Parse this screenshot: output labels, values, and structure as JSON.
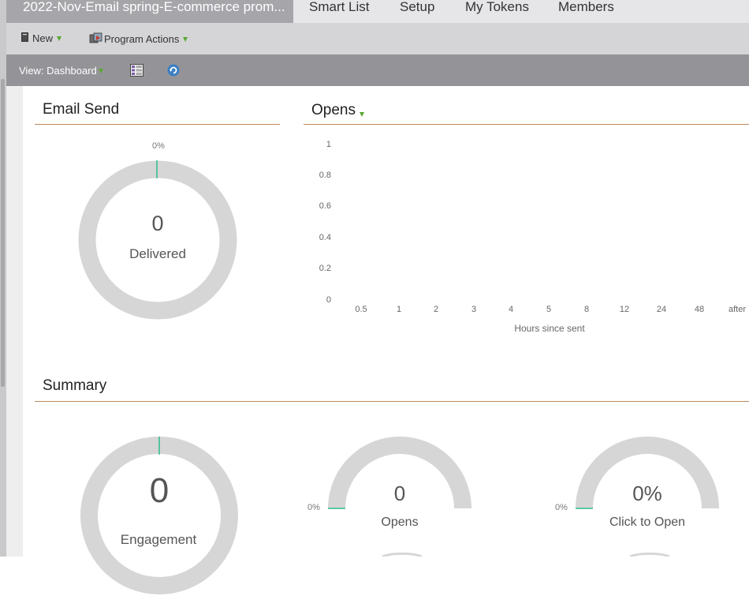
{
  "header": {
    "active_tab": "2022-Nov-Email spring-E-commerce prom...",
    "tabs": [
      "Smart List",
      "Setup",
      "My Tokens",
      "Members"
    ]
  },
  "toolbar": {
    "new_label": "New",
    "program_actions_label": "Program Actions"
  },
  "viewbar": {
    "view_label": "View: Dashboard"
  },
  "email_send": {
    "title": "Email Send",
    "percent_label": "0%",
    "count": "0",
    "label": "Delivered"
  },
  "opens_chart": {
    "title": "Opens",
    "y_ticks": [
      "1",
      "0.8",
      "0.6",
      "0.4",
      "0.2",
      "0"
    ],
    "x_ticks": [
      "0.5",
      "1",
      "2",
      "3",
      "4",
      "5",
      "8",
      "12",
      "24",
      "48",
      "after"
    ],
    "xlabel": "Hours since sent"
  },
  "chart_data": {
    "type": "line",
    "title": "Opens",
    "xlabel": "Hours since sent",
    "ylabel": "",
    "categories": [
      "0.5",
      "1",
      "2",
      "3",
      "4",
      "5",
      "8",
      "12",
      "24",
      "48",
      "after"
    ],
    "series": [
      {
        "values": [
          0,
          0,
          0,
          0,
          0,
          0,
          0,
          0,
          0,
          0,
          0
        ]
      }
    ],
    "ylim": [
      0,
      1
    ],
    "grid": false
  },
  "summary": {
    "title": "Summary",
    "engagement": {
      "count": "0",
      "label": "Engagement"
    },
    "opens": {
      "count": "0",
      "label": "Opens",
      "percent_label": "0%"
    },
    "click_to_open": {
      "count": "0%",
      "label": "Click to Open",
      "percent_label": "0%"
    }
  },
  "colors": {
    "accent_green": "#2bbf8f",
    "ring_gray": "#d6d6d6",
    "section_rule": "#c08a5a",
    "active_tab_bg": "#a6a6aa",
    "viewbar_bg": "#949498"
  }
}
